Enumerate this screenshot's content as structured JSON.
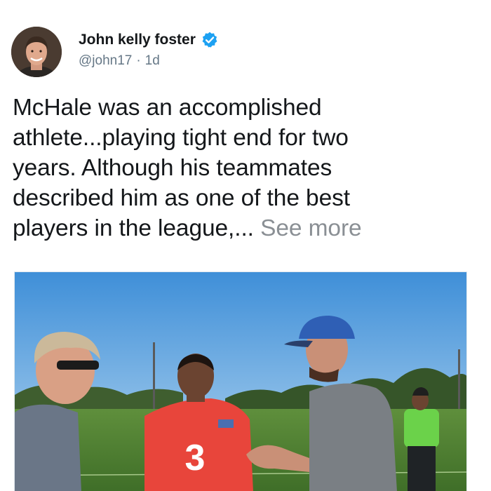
{
  "tweet": {
    "author": {
      "display_name": "John kelly foster",
      "handle": "@john17",
      "separator": "·",
      "time": "1d",
      "verified": true,
      "avatar_icon": "user-avatar"
    },
    "text": {
      "line1": "McHale was an accomplished",
      "line2": "athlete...playing tight end for two",
      "line3": "years. Although his teammates",
      "line4": "described him as one of the best",
      "line5": "players in the league,...",
      "see_more": "See more"
    },
    "media": {
      "type": "photo",
      "jersey_number": "3"
    }
  },
  "colors": {
    "verified_blue": "#1da1f2",
    "handle_gray": "#657786",
    "see_more_gray": "#8a8f94",
    "text": "#14171a"
  }
}
